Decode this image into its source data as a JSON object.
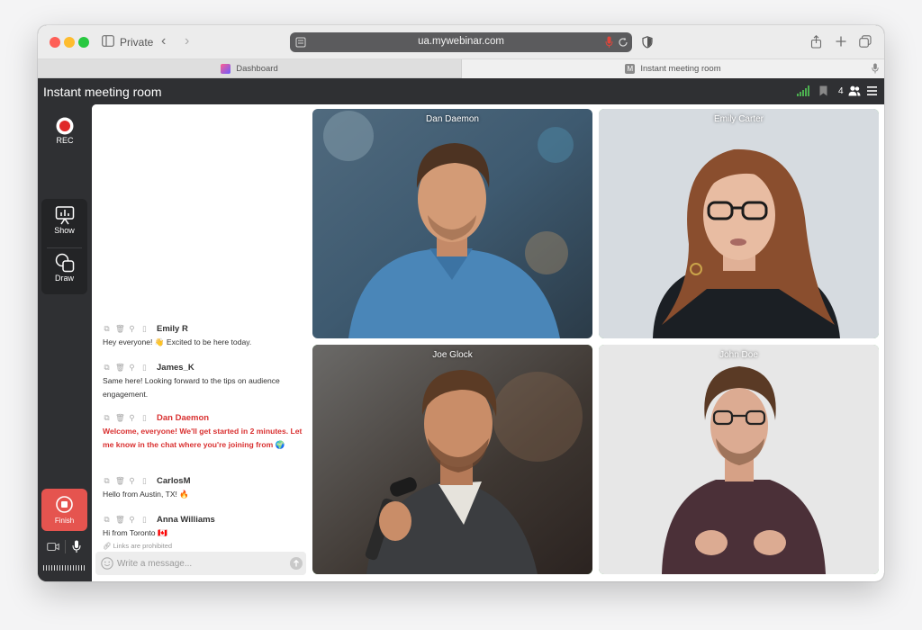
{
  "browser": {
    "mode_label": "Private",
    "url": "ua.mywebinar.com",
    "tabs": [
      {
        "label": "Dashboard",
        "active": false
      },
      {
        "label": "Instant meeting room",
        "active": true
      }
    ],
    "m_favicon_letter": "M"
  },
  "header": {
    "title": "Instant meeting room",
    "participant_count": "4"
  },
  "rail": {
    "rec_label": "REC",
    "show_label": "Show",
    "draw_label": "Draw",
    "finish_label": "Finish"
  },
  "chat": {
    "messages": [
      {
        "author": "Emily R",
        "text": "Hey everyone! 👋 Excited to be here today.",
        "host": false
      },
      {
        "author": "James_K",
        "text": "Same here! Looking forward to the tips on audience engagement.",
        "host": false
      },
      {
        "author": "Dan Daemon",
        "text": "Welcome, everyone! We'll get started in 2 minutes. Let me know in the chat where you're joining from 🌍",
        "host": true
      },
      {
        "author": "CarlosM",
        "text": "Hello from Austin, TX! 🔥",
        "host": false
      },
      {
        "author": "Anna Williams",
        "text": "Hi from Toronto 🇨🇦",
        "host": false
      }
    ],
    "links_note": "Links are prohibited",
    "input_placeholder": "Write a message..."
  },
  "videos": [
    {
      "name": "Dan Daemon",
      "active": false
    },
    {
      "name": "Emily Carter",
      "active": true
    },
    {
      "name": "Joe Glock",
      "active": true
    },
    {
      "name": "John Doe",
      "active": true
    }
  ],
  "colors": {
    "accent_green": "#4caf50",
    "host_red": "#d93030",
    "finish_red": "#e5544f",
    "rec_red": "#e02828",
    "dark_bg": "#2f3033"
  }
}
